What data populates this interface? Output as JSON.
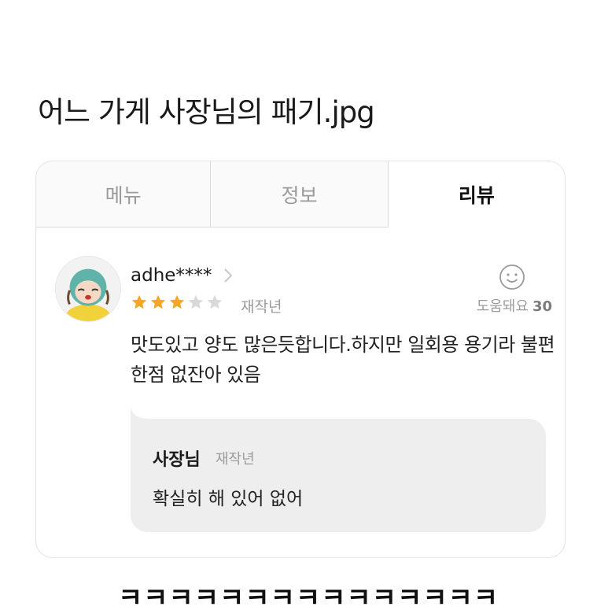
{
  "post": {
    "title": "어느 가게 사장님의 패기.jpg",
    "caption": "ㅋㅋㅋㅋㅋㅋㅋㅋㅋㅋㅋㅋㅋㅋㅋ"
  },
  "tabs": [
    {
      "label": "메뉴",
      "active": false
    },
    {
      "label": "정보",
      "active": false
    },
    {
      "label": "리뷰",
      "active": true
    }
  ],
  "review": {
    "username": "adhe****",
    "rating": 3,
    "max_rating": 5,
    "date": "재작년",
    "helpful_label": "도움돼요",
    "helpful_count": "30",
    "text": "맛도있고 양도 많은듯합니다.하지만 일회용 용기라 불편한점 없잔아 있음"
  },
  "reply": {
    "author": "사장님",
    "date": "재작년",
    "text": "확실히 해 있어 없어"
  },
  "colors": {
    "star_filled": "#f5a623",
    "star_empty": "#d9d9d9",
    "reply_bg": "#eeeeee",
    "avatar_bg": "#5fb3a8"
  },
  "icons": {
    "chevron": "chevron-right-icon",
    "helpful": "smiley-icon",
    "star": "star-icon"
  }
}
